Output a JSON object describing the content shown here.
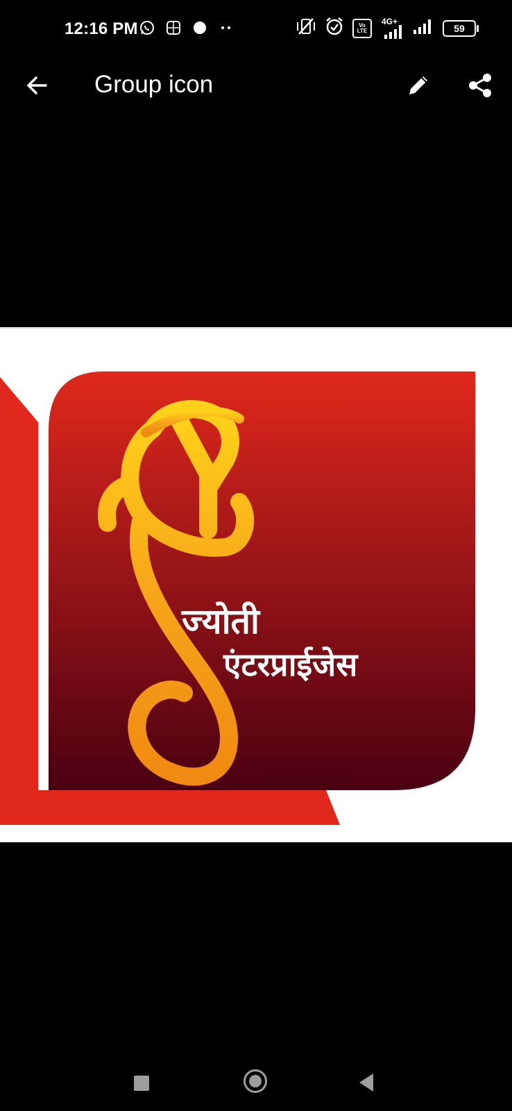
{
  "status_bar": {
    "time": "12:16 PM",
    "left_icons": [
      "whatsapp-icon",
      "sim-app-icon",
      "dot-icon",
      "more-dots-icon"
    ],
    "right_icons": [
      "vibrate-off-icon",
      "alarm-icon",
      "volte-icon",
      "signal-4g-icon",
      "signal-icon",
      "battery-icon"
    ],
    "network_label": "4G+",
    "volte_label": "Vo LTE",
    "battery_level": "59"
  },
  "app_bar": {
    "title": "Group icon",
    "back_icon": "arrow-left-icon",
    "edit_icon": "pencil-icon",
    "share_icon": "share-icon"
  },
  "image": {
    "line1": "ज्योती",
    "line2": "एंटरप्राईजेस",
    "colors": {
      "red_bright": "#e0281c",
      "maroon_dark": "#4a0012",
      "gold": "#f7b21a",
      "orange": "#f28a12",
      "white": "#ffffff"
    }
  },
  "nav_bar": {
    "recents_icon": "square-icon",
    "home_icon": "circle-icon",
    "back_icon": "triangle-back-icon"
  }
}
